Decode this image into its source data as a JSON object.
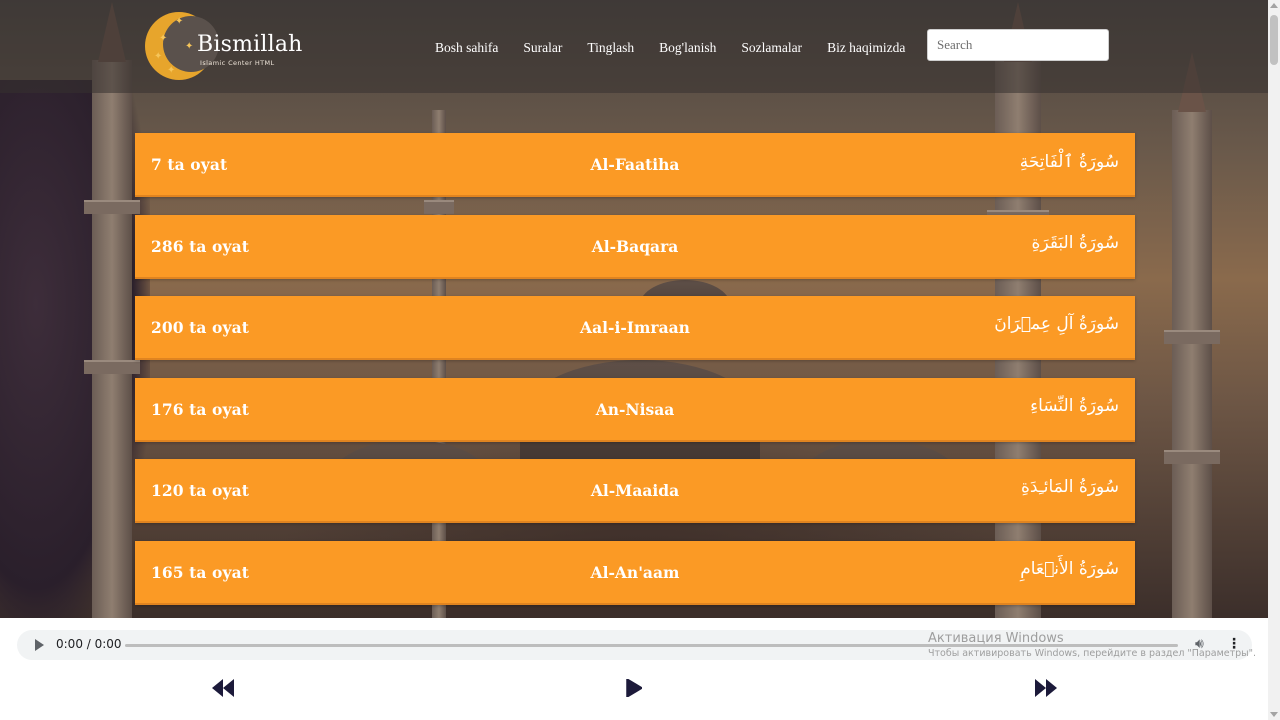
{
  "brand": {
    "title": "Bismillah",
    "subtitle": "Islamic Center HTML"
  },
  "nav": {
    "items": [
      {
        "label": "Bosh sahifa"
      },
      {
        "label": "Suralar"
      },
      {
        "label": "Tinglash"
      },
      {
        "label": "Bog'lanish"
      },
      {
        "label": "Sozlamalar"
      },
      {
        "label": "Biz haqimizda"
      }
    ]
  },
  "search": {
    "placeholder": "Search",
    "value": ""
  },
  "surahs": [
    {
      "ayah_count": "7 ta oyat",
      "name": "Al-Faatiha",
      "arabic": "سُورَةُ ٱلْفَاتِحَةِ"
    },
    {
      "ayah_count": "286 ta oyat",
      "name": "Al-Baqara",
      "arabic": "سُورَةُ البَقَرَةِ"
    },
    {
      "ayah_count": "200 ta oyat",
      "name": "Aal-i-Imraan",
      "arabic": "سُورَةُ آلِ عِمۡرَانَ"
    },
    {
      "ayah_count": "176 ta oyat",
      "name": "An-Nisaa",
      "arabic": "سُورَةُ النِّسَاءِ"
    },
    {
      "ayah_count": "120 ta oyat",
      "name": "Al-Maaida",
      "arabic": "سُورَةُ المَائـِدَةِ"
    },
    {
      "ayah_count": "165 ta oyat",
      "name": "Al-An'aam",
      "arabic": "سُورَةُ الأَنۡعَامِ"
    }
  ],
  "player": {
    "time": "0:00 / 0:00",
    "progress": 0
  },
  "watermark": {
    "line1": "Активация Windows",
    "line2": "Чтобы активировать Windows, перейдите в раздел \"Параметры\"."
  },
  "colors": {
    "surah_bg": "#fb9a25",
    "accent_gold": "#e7a52c",
    "control_dark": "#1c1a3a"
  },
  "icons": {
    "prev": "rewind-icon",
    "play": "play-icon",
    "next": "fast-forward-icon"
  }
}
